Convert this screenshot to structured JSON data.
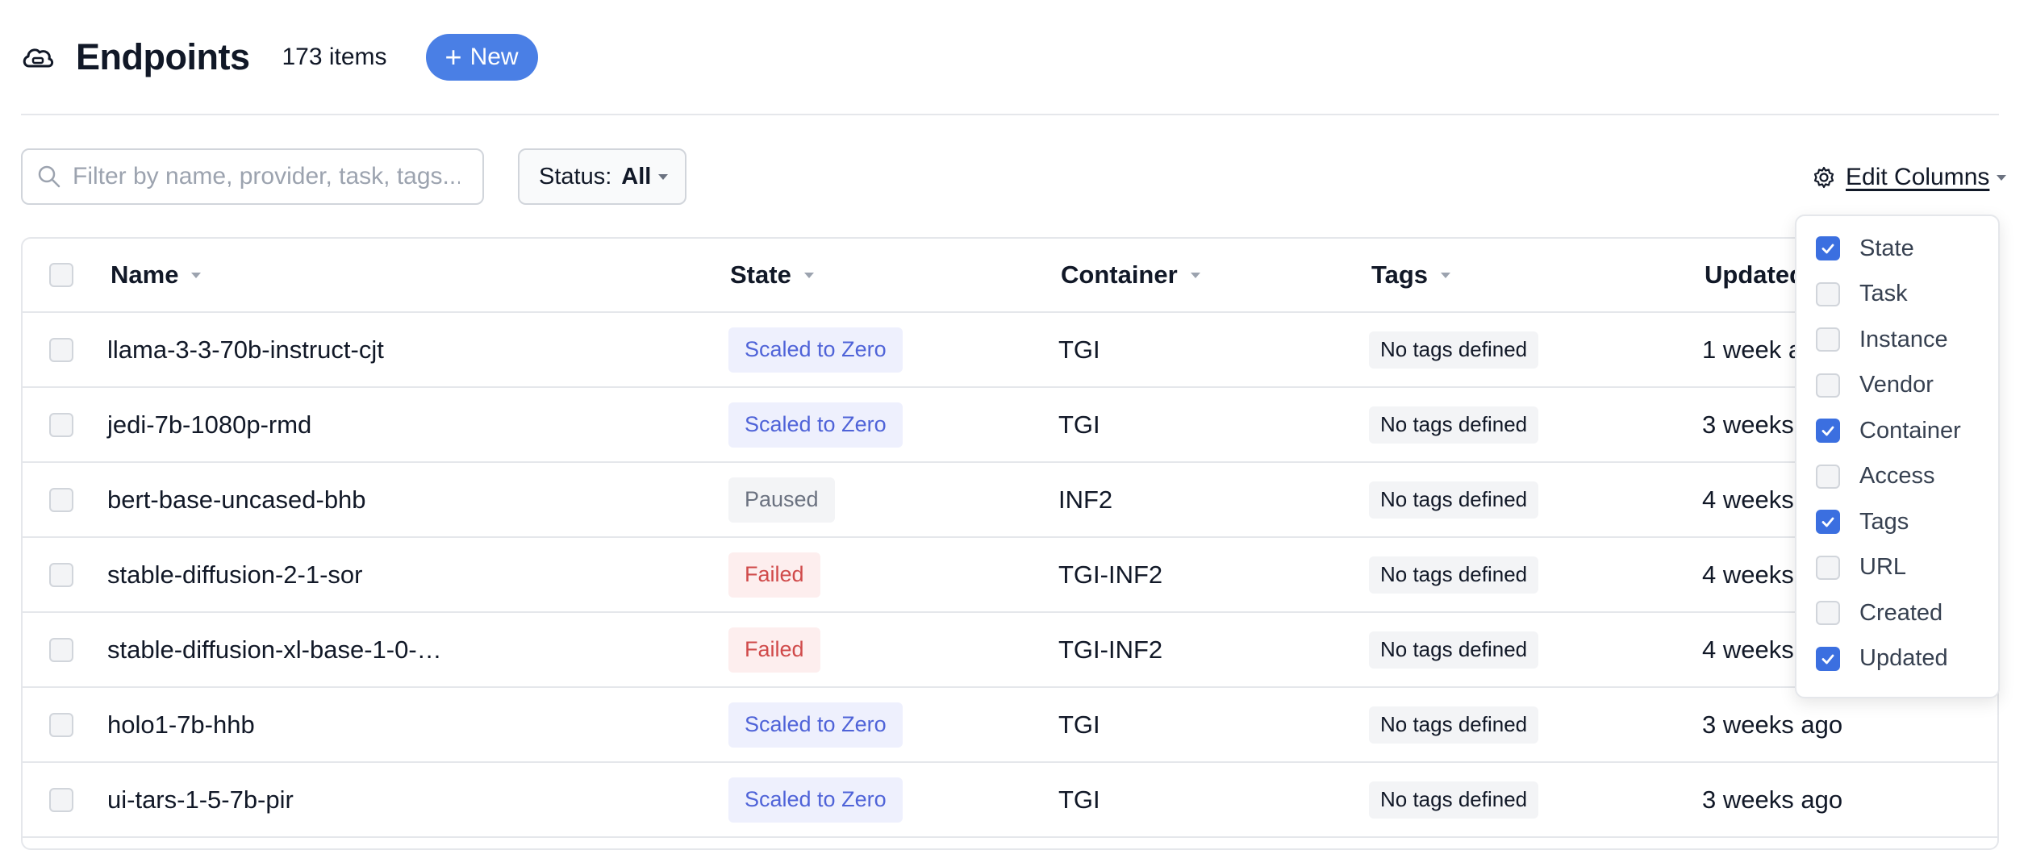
{
  "header": {
    "title": "Endpoints",
    "count": "173 items",
    "new_label": "New"
  },
  "filters": {
    "search_placeholder": "Filter by name, provider, task, tags...",
    "status_label": "Status:",
    "status_value": "All",
    "edit_columns_label": "Edit Columns"
  },
  "table": {
    "columns": [
      "Name",
      "State",
      "Container",
      "Tags",
      "Updated"
    ],
    "rows": [
      {
        "name": "llama-3-3-70b-instruct-cjt",
        "state": "Scaled to Zero",
        "state_kind": "scaled",
        "container": "TGI",
        "tags": "No tags defined",
        "updated": "1 week ago"
      },
      {
        "name": "jedi-7b-1080p-rmd",
        "state": "Scaled to Zero",
        "state_kind": "scaled",
        "container": "TGI",
        "tags": "No tags defined",
        "updated": "3 weeks ago"
      },
      {
        "name": "bert-base-uncased-bhb",
        "state": "Paused",
        "state_kind": "paused",
        "container": "INF2",
        "tags": "No tags defined",
        "updated": "4 weeks ago"
      },
      {
        "name": "stable-diffusion-2-1-sor",
        "state": "Failed",
        "state_kind": "failed",
        "container": "TGI-INF2",
        "tags": "No tags defined",
        "updated": "4 weeks ago"
      },
      {
        "name": "stable-diffusion-xl-base-1-0-…",
        "state": "Failed",
        "state_kind": "failed",
        "container": "TGI-INF2",
        "tags": "No tags defined",
        "updated": "4 weeks ago"
      },
      {
        "name": "holo1-7b-hhb",
        "state": "Scaled to Zero",
        "state_kind": "scaled",
        "container": "TGI",
        "tags": "No tags defined",
        "updated": "3 weeks ago"
      },
      {
        "name": "ui-tars-1-5-7b-pir",
        "state": "Scaled to Zero",
        "state_kind": "scaled",
        "container": "TGI",
        "tags": "No tags defined",
        "updated": "3 weeks ago"
      }
    ]
  },
  "column_menu": {
    "options": [
      {
        "label": "State",
        "checked": true
      },
      {
        "label": "Task",
        "checked": false
      },
      {
        "label": "Instance",
        "checked": false
      },
      {
        "label": "Vendor",
        "checked": false
      },
      {
        "label": "Container",
        "checked": true
      },
      {
        "label": "Access",
        "checked": false
      },
      {
        "label": "Tags",
        "checked": true
      },
      {
        "label": "URL",
        "checked": false
      },
      {
        "label": "Created",
        "checked": false
      },
      {
        "label": "Updated",
        "checked": true
      }
    ]
  },
  "colors": {
    "accent": "#4a7fe5",
    "checkbox_on": "#3b6fe0",
    "scaled_text": "#4f63d8",
    "failed_text": "#d04a4a",
    "paused_text": "#6b7280"
  },
  "icons": {
    "header": "cloud-icon",
    "new": "plus-icon",
    "search": "search-icon",
    "edit_columns": "gear-icon"
  }
}
